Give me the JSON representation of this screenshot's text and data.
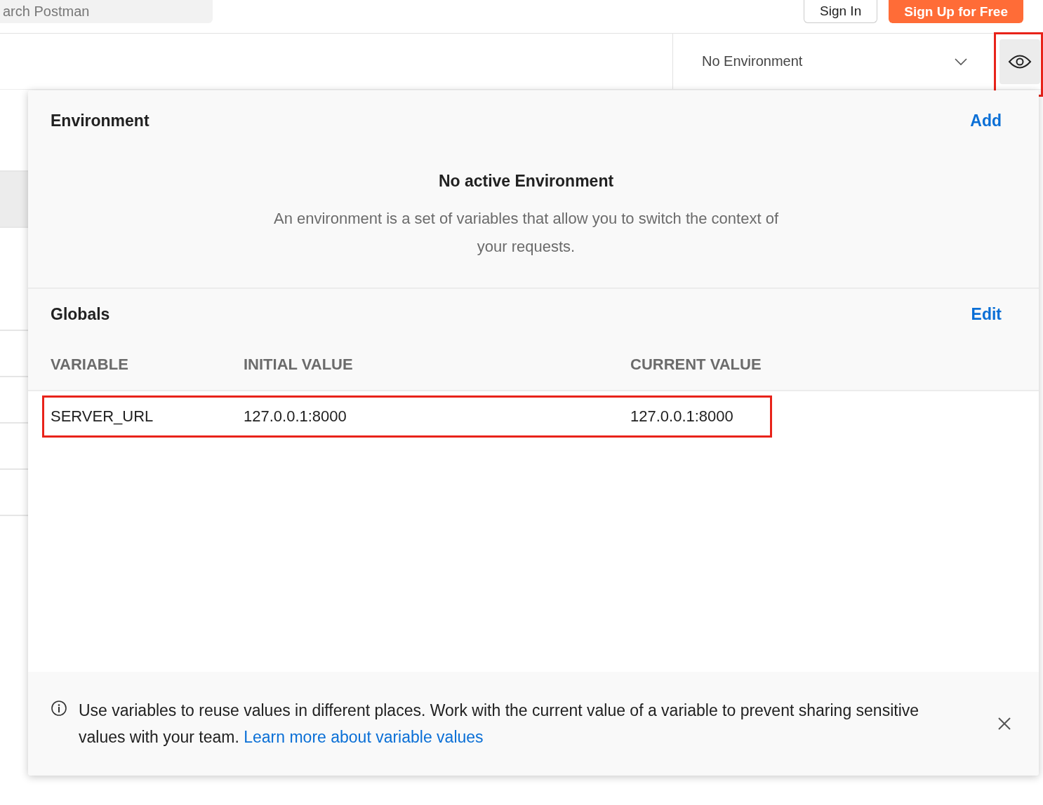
{
  "header": {
    "search": {
      "placeholder": "arch Postman"
    },
    "buttons": [
      {
        "label": "Sign In",
        "kind": "outline"
      },
      {
        "label": "Sign Up for Free",
        "kind": "primary"
      }
    ]
  },
  "environment_bar": {
    "selector": {
      "value": "No Environment"
    },
    "quick_look": {
      "highlighted": true
    }
  },
  "popup": {
    "environment": {
      "title": "Environment",
      "action": "Add",
      "empty_title": "No active Environment",
      "empty_text": "An environment is a set of variables that allow you to switch the context of your requests."
    },
    "globals": {
      "title": "Globals",
      "action": "Edit",
      "columns": [
        "VARIABLE",
        "INITIAL VALUE",
        "CURRENT VALUE"
      ],
      "rows": [
        {
          "cells": [
            "SERVER_URL",
            "127.0.0.1:8000",
            "127.0.0.1:8000"
          ],
          "highlighted": true
        }
      ]
    },
    "info": {
      "text": "Use variables to reuse values in different places. Work with the current value of a variable to prevent sharing sensitive values with your team.",
      "link": "Learn more about variable values"
    }
  }
}
